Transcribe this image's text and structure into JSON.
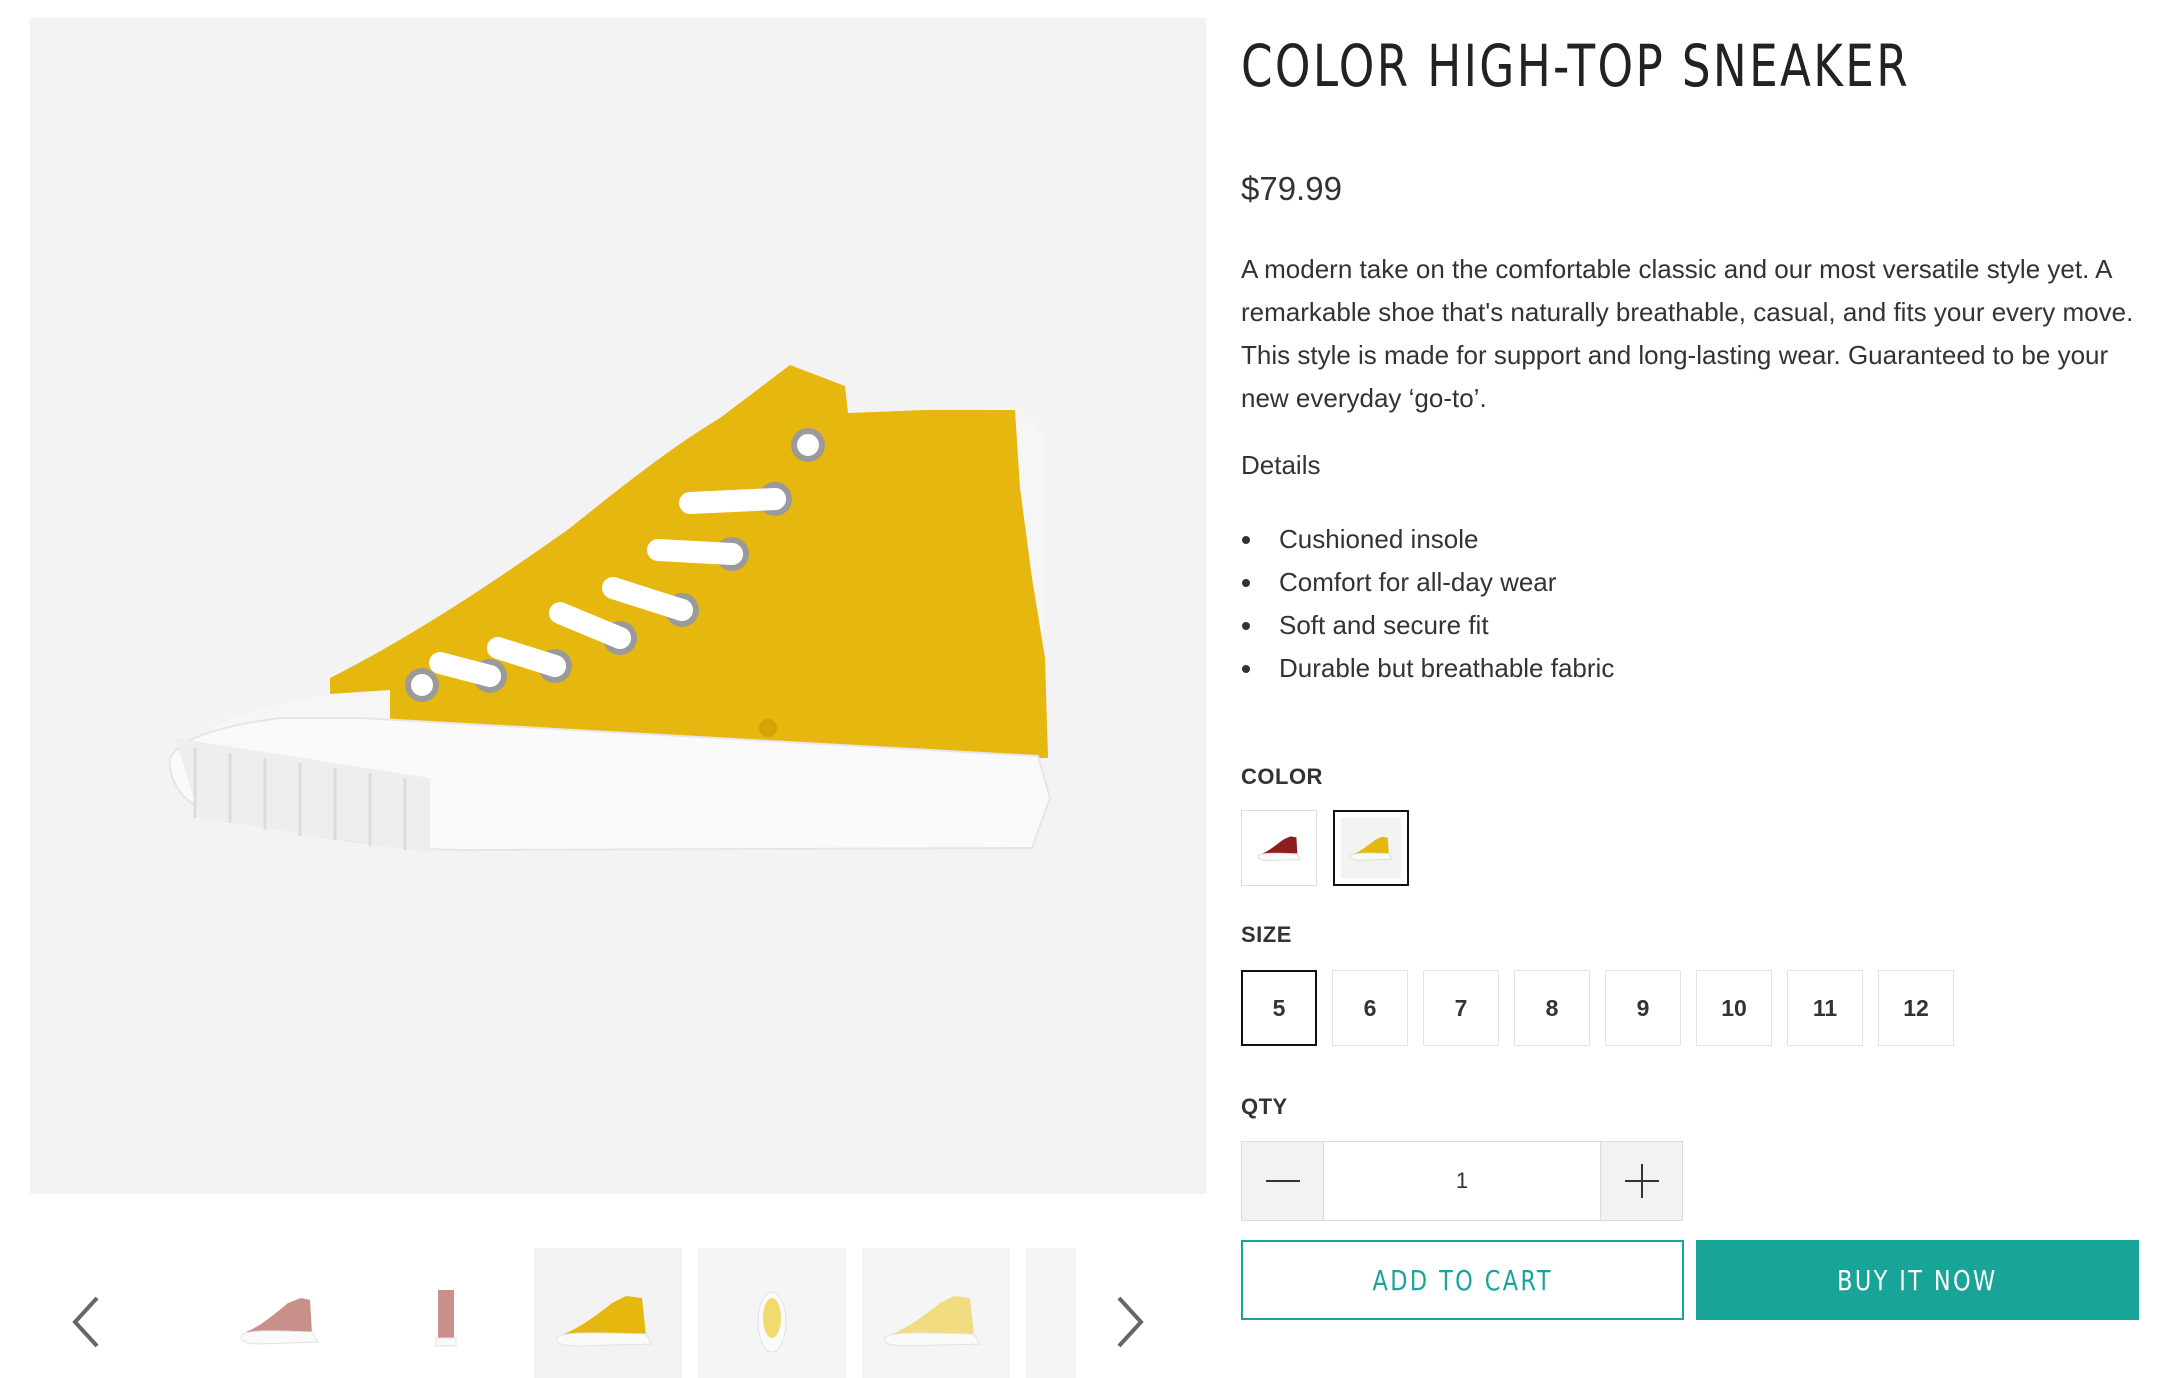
{
  "product": {
    "title": "COLOR HIGH-TOP SNEAKER",
    "price": "$79.99",
    "description": "A modern take on the comfortable classic and our most versatile style yet. A remarkable shoe that's naturally breathable, casual, and fits your every move. This style is made for support and long-lasting wear. Guaranteed to be your new everyday ‘go-to’.",
    "details_heading": "Details",
    "features": [
      "Cushioned insole",
      "Comfort for all-day wear",
      "Soft and secure fit",
      "Durable but breathable fabric"
    ]
  },
  "options": {
    "color_label": "COLOR",
    "colors": [
      {
        "name": "Maroon",
        "hex": "#8e1d1d",
        "selected": false
      },
      {
        "name": "Yellow",
        "hex": "#e6b70e",
        "selected": true
      }
    ],
    "size_label": "SIZE",
    "sizes": [
      "5",
      "6",
      "7",
      "8",
      "9",
      "10",
      "11",
      "12"
    ],
    "selected_size": "5",
    "qty_label": "QTY",
    "qty_value": "1"
  },
  "actions": {
    "add_to_cart": "ADD TO CART",
    "buy_now": "BUY IT NOW"
  },
  "gallery": {
    "main_image_icon": "yellow-high-top-sneaker-side-view",
    "thumbnails": [
      {
        "icon": "pink-sneaker-side-icon",
        "color": "#c98f8a"
      },
      {
        "icon": "pink-sneaker-back-icon",
        "color": "#c98f8a"
      },
      {
        "icon": "yellow-sneaker-side-icon",
        "color": "#e6b70e",
        "active": true
      },
      {
        "icon": "yellow-sneaker-top-icon",
        "color": "#f1da6e"
      },
      {
        "icon": "light-yellow-sneaker-side-icon",
        "color": "#f2dc82"
      }
    ]
  },
  "colors": {
    "accent": "#18a497",
    "image_background": "#f3f3f3"
  }
}
